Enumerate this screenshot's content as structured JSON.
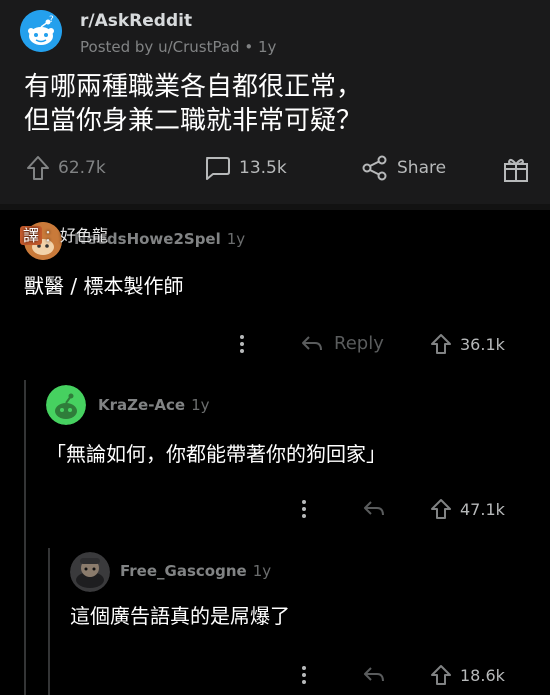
{
  "post": {
    "subreddit": "r/AskReddit",
    "meta": "Posted by u/CrustPad • 1y",
    "title_line1": "有哪兩種職業各自都很正常，",
    "title_line2": "但當你身兼二職就非常可疑？",
    "upvotes": "62.7k",
    "comments": "13.5k",
    "share_label": "Share"
  },
  "watermark": {
    "tag": "譯",
    "text": "：好色龍"
  },
  "comments": [
    {
      "author": "NeedsHowe2Spel",
      "age": "1y",
      "body": "獸醫 / 標本製作師",
      "reply_label": "Reply",
      "votes": "36.1k"
    },
    {
      "author": "KraZe-Ace",
      "age": "1y",
      "body": "「無論如何，你都能帶著你的狗回家」",
      "votes": "47.1k"
    },
    {
      "author": "Free_Gascogne",
      "age": "1y",
      "body": "這個廣告語真的是屌爆了",
      "votes": "18.6k"
    }
  ],
  "icons": {
    "subreddit_avatar": "reddit-snoo-icon",
    "upvote": "upvote-arrow-icon",
    "comment": "comment-bubble-icon",
    "share": "share-icon",
    "award": "award-gift-icon",
    "more": "more-vertical-icon",
    "reply": "reply-arrow-icon"
  },
  "colors": {
    "background": "#000000",
    "post_background": "#1a1a1b",
    "muted_text": "#818384",
    "subreddit_avatar": "#24a0ed",
    "kraze_avatar": "#46d160"
  }
}
